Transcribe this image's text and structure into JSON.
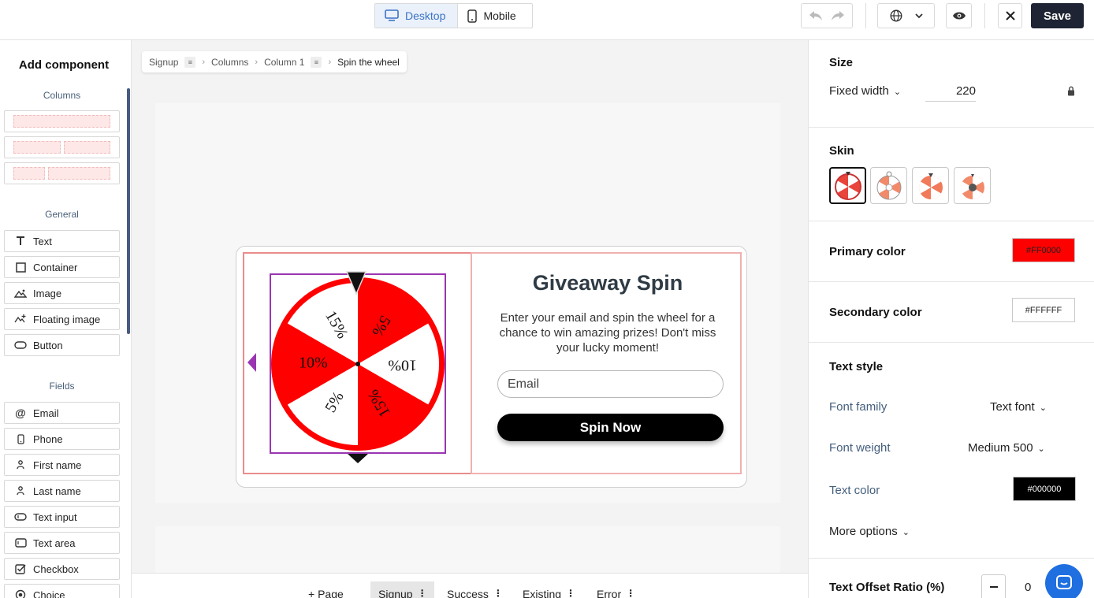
{
  "topbar": {
    "device_desktop": "Desktop",
    "device_mobile": "Mobile",
    "save_label": "Save"
  },
  "left_panel": {
    "title": "Add component",
    "sections": {
      "columns": "Columns",
      "general": "General",
      "fields": "Fields"
    },
    "general_items": [
      "Text",
      "Container",
      "Image",
      "Floating image",
      "Button"
    ],
    "field_items": [
      "Email",
      "Phone",
      "First name",
      "Last name",
      "Text input",
      "Text area",
      "Checkbox",
      "Choice"
    ]
  },
  "breadcrumb": [
    "Signup",
    "Columns",
    "Column 1",
    "Spin the wheel"
  ],
  "popup": {
    "title": "Giveaway Spin",
    "description": "Enter your email and spin the wheel for a chance to win amazing prizes! Don't miss your lucky moment!",
    "email_placeholder": "Email",
    "button_label": "Spin Now",
    "wheel_segments": [
      "5%",
      "10%",
      "15%",
      "5%",
      "10%",
      "15%"
    ]
  },
  "bottom_tabs": {
    "add_page": "+ Page",
    "tabs": [
      "Signup",
      "Success",
      "Existing",
      "Error"
    ],
    "active": "Signup"
  },
  "right_panel": {
    "size": {
      "heading": "Size",
      "mode": "Fixed width",
      "value": "220"
    },
    "skin": {
      "heading": "Skin",
      "selected_index": 0
    },
    "primary_color": {
      "label": "Primary color",
      "value": "#FF0000"
    },
    "secondary_color": {
      "label": "Secondary color",
      "value": "#FFFFFF"
    },
    "text_style": {
      "heading": "Text style",
      "font_family_label": "Font family",
      "font_family_value": "Text font",
      "font_weight_label": "Font weight",
      "font_weight_value": "Medium 500",
      "text_color_label": "Text color",
      "text_color_value": "#000000",
      "more_options": "More options"
    },
    "text_offset": {
      "label": "Text Offset Ratio (%)",
      "value": "0"
    }
  },
  "colors": {
    "accent_navy": "#1e2433",
    "wheel_red": "#FF0000",
    "selection_purple": "#9a36b2"
  }
}
